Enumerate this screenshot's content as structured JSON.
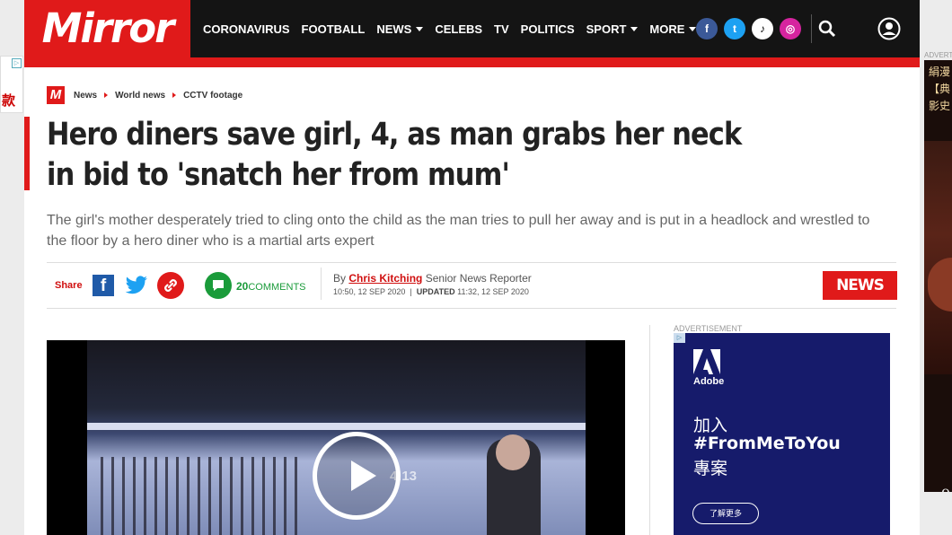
{
  "left_ad": {
    "text": "款"
  },
  "right_ad": {
    "label": "ADVERT",
    "text": "絹漫【典影史",
    "number": "9"
  },
  "header": {
    "logo": "Mirror",
    "nav": [
      {
        "label": "CORONAVIRUS",
        "dropdown": false
      },
      {
        "label": "FOOTBALL",
        "dropdown": false
      },
      {
        "label": "NEWS",
        "dropdown": true
      },
      {
        "label": "CELEBS",
        "dropdown": false
      },
      {
        "label": "TV",
        "dropdown": false
      },
      {
        "label": "POLITICS",
        "dropdown": false
      },
      {
        "label": "SPORT",
        "dropdown": true
      },
      {
        "label": "MORE",
        "dropdown": true
      }
    ],
    "social": [
      {
        "name": "facebook",
        "glyph": "f",
        "color": "#3b5998"
      },
      {
        "name": "twitter",
        "glyph": "t",
        "color": "#1da1f2"
      },
      {
        "name": "tiktok",
        "glyph": "♪",
        "color": "#ffffff"
      },
      {
        "name": "instagram",
        "glyph": "◎",
        "color": "#d6249f"
      }
    ]
  },
  "breadcrumb": {
    "badge": "M",
    "items": [
      "News",
      "World news",
      "CCTV footage"
    ]
  },
  "article": {
    "headline": "Hero diners save girl, 4, as man grabs her neck in bid to 'snatch her from mum'",
    "standfirst": "The girl's mother desperately tried to cling onto the child as the man tries to pull her away and is put in a headlock and wrestled to the floor by a hero diner who is a martial arts expert",
    "share_label": "Share",
    "comments_count": "20",
    "comments_label": "COMMENTS",
    "by": "By",
    "author": "Chris Kitching",
    "author_role": "Senior News Reporter",
    "published": "10:50, 12 SEP 2020",
    "updated_label": "UPDATED",
    "updated": "11:32, 12 SEP 2020",
    "section_tag": "NEWS"
  },
  "video": {
    "timestamp_overlay": "4:13"
  },
  "sidebar_ad": {
    "label": "ADVERTISEMENT",
    "brand": "Adobe",
    "line1": "加入",
    "line2": "#FromMeToYou",
    "line3": "專案",
    "button": "了解更多"
  },
  "colors": {
    "brand_red": "#e01a1a",
    "comments_green": "#1a9b3a",
    "ad_blue": "#161b6b"
  }
}
